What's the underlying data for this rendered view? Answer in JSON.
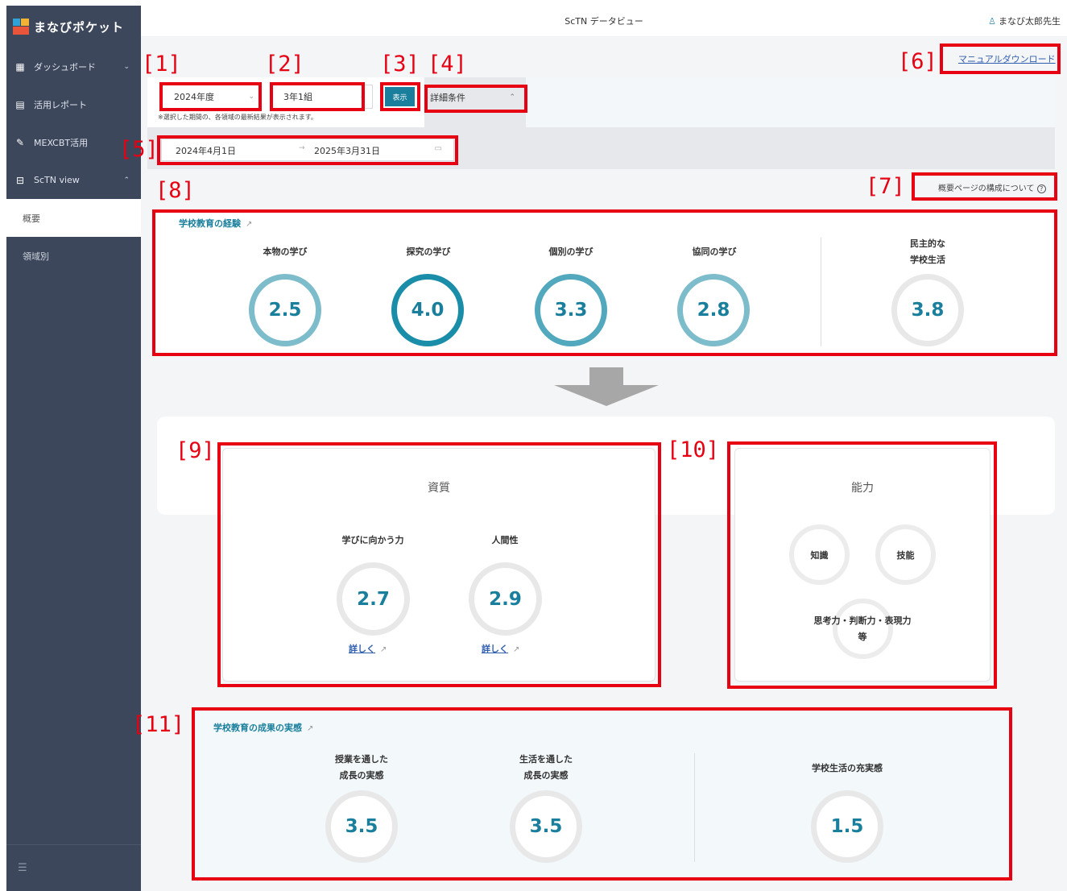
{
  "app": {
    "logo_text": "まなびポケット",
    "header_title": "ScTN データビュー",
    "user_name": "まなび太郎先生"
  },
  "sidebar": {
    "items": [
      {
        "label": "ダッシュボード",
        "icon": "dashboard-icon"
      },
      {
        "label": "活用レポート",
        "icon": "report-icon"
      },
      {
        "label": "MEXCBT活用",
        "icon": "pencil-icon"
      },
      {
        "label": "ScTN view",
        "icon": "data-view-icon"
      }
    ],
    "sub_items": [
      "概要",
      "領域別"
    ]
  },
  "filters": {
    "year": "2024年度",
    "class": "3年1組",
    "show_button": "表示",
    "detail_conditions": "詳細条件",
    "note": "※選択した期間の、各領域の最新結果が表示されます。",
    "date_start": "2024年4月1日",
    "date_end": "2025年3月31日"
  },
  "links": {
    "manual_download": "マニュアルダウンロード",
    "about_layout": "概要ページの構成について"
  },
  "markers": [
    "[1]",
    "[2]",
    "[3]",
    "[4]",
    "[5]",
    "[6]",
    "[7]",
    "[8]",
    "[9]",
    "[10]",
    "[11]"
  ],
  "experience": {
    "title": "学校教育の経験",
    "metrics": [
      {
        "label": "本物の学び",
        "value": "2.5"
      },
      {
        "label": "探究の学び",
        "value": "4.0"
      },
      {
        "label": "個別の学び",
        "value": "3.3"
      },
      {
        "label": "協同の学び",
        "value": "2.8"
      }
    ],
    "democratic_label_line1": "民主的な",
    "democratic_label_line2": "学校生活",
    "democratic_value": "3.8"
  },
  "qualities": {
    "title": "資質",
    "metrics": [
      {
        "label": "学びに向かう力",
        "value": "2.7",
        "link": "詳しく"
      },
      {
        "label": "人間性",
        "value": "2.9",
        "link": "詳しく"
      }
    ]
  },
  "abilities": {
    "title": "能力",
    "items": [
      "知識",
      "技能"
    ],
    "thinking_line1": "思考力・判断力・表現力",
    "thinking_line2": "等"
  },
  "outcomes": {
    "title": "学校教育の成果の実感",
    "metrics": [
      {
        "label_line1": "授業を通した",
        "label_line2": "成長の実感",
        "value": "3.5"
      },
      {
        "label_line1": "生活を通した",
        "label_line2": "成長の実感",
        "value": "3.5"
      }
    ],
    "school_life_label": "学校生活の充実感",
    "school_life_value": "1.5"
  },
  "colors": {
    "accent": "#1a7f9c",
    "sidebar": "#3c475b",
    "marker": "#e60012",
    "link": "#2f5fae"
  }
}
